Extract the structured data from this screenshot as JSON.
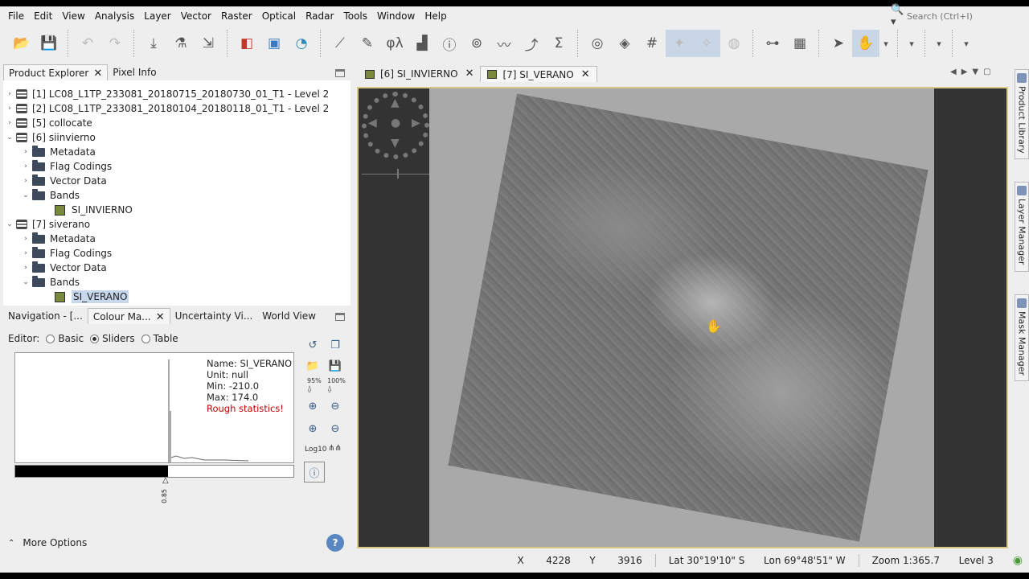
{
  "menubar": {
    "items": [
      "File",
      "Edit",
      "View",
      "Analysis",
      "Layer",
      "Vector",
      "Raster",
      "Optical",
      "Radar",
      "Tools",
      "Window",
      "Help"
    ],
    "search_placeholder": "Search (Ctrl+I)"
  },
  "left_top_panel": {
    "tabs": [
      {
        "label": "Product Explorer",
        "closable": true
      },
      {
        "label": "Pixel Info",
        "closable": false
      }
    ],
    "tree": [
      {
        "label": "[1] LC08_L1TP_233081_20180715_20180730_01_T1 - Level 2",
        "type": "product",
        "indent": 0,
        "expanded": false
      },
      {
        "label": "[2] LC08_L1TP_233081_20180104_20180118_01_T1 - Level 2",
        "type": "product",
        "indent": 0,
        "expanded": false
      },
      {
        "label": "[5] collocate",
        "type": "product",
        "indent": 0,
        "expanded": false
      },
      {
        "label": "[6] siinvierno",
        "type": "product",
        "indent": 0,
        "expanded": true
      },
      {
        "label": "Metadata",
        "type": "folder",
        "indent": 1,
        "expanded": false
      },
      {
        "label": "Flag Codings",
        "type": "folder",
        "indent": 1,
        "expanded": false
      },
      {
        "label": "Vector Data",
        "type": "folder",
        "indent": 1,
        "expanded": false
      },
      {
        "label": "Bands",
        "type": "folder",
        "indent": 1,
        "expanded": true
      },
      {
        "label": "SI_INVIERNO",
        "type": "band",
        "indent": 2,
        "selected": false
      },
      {
        "label": "[7] siverano",
        "type": "product",
        "indent": 0,
        "expanded": true
      },
      {
        "label": "Metadata",
        "type": "folder",
        "indent": 1,
        "expanded": false
      },
      {
        "label": "Flag Codings",
        "type": "folder",
        "indent": 1,
        "expanded": false
      },
      {
        "label": "Vector Data",
        "type": "folder",
        "indent": 1,
        "expanded": false
      },
      {
        "label": "Bands",
        "type": "folder",
        "indent": 1,
        "expanded": true
      },
      {
        "label": "SI_VERANO",
        "type": "band",
        "indent": 2,
        "selected": true
      }
    ]
  },
  "left_bottom_panel": {
    "tabs": [
      "Navigation - [...",
      "Colour Ma...",
      "Uncertainty Vi...",
      "World View"
    ],
    "editor_label": "Editor:",
    "editor_modes": [
      "Basic",
      "Sliders",
      "Table"
    ],
    "editor_selected": "Sliders",
    "info": {
      "name": "Name: SI_VERANO",
      "unit": "Unit: null",
      "min": "Min: -210.0",
      "max": "Max: 174.0",
      "warning": "Rough statistics!"
    },
    "slider_value": "0.85",
    "slider_position_fraction": 0.55,
    "percent_95": "95%",
    "percent_100": "100%",
    "log_label": "Log10",
    "more_options": "More Options"
  },
  "document_tabs": [
    {
      "label": "[6] SI_INVIERNO",
      "active": false
    },
    {
      "label": "[7] SI_VERANO",
      "active": true
    }
  ],
  "right_side_tabs": [
    "Product Library",
    "Layer Manager",
    "Mask Manager"
  ],
  "status_bar": {
    "x_label": "X",
    "x_value": "4228",
    "y_label": "Y",
    "y_value": "3916",
    "lat": "Lat 30°19'10\" S",
    "lon": "Lon 69°48'51\" W",
    "zoom": "Zoom 1:365.7",
    "level": "Level 3"
  },
  "colors": {
    "selection": "#c7d7ec",
    "viewport_border": "#d9c882",
    "warning": "#c00000"
  }
}
